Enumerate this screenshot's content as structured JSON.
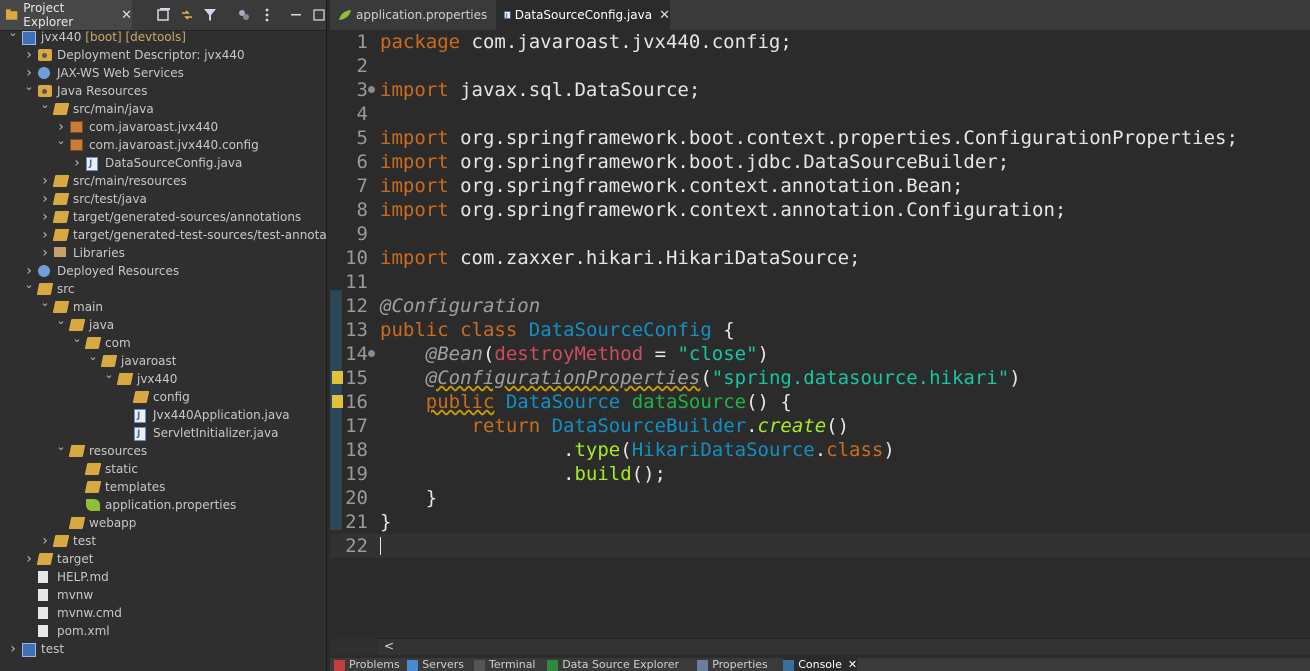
{
  "explorer": {
    "title": "Project Explorer",
    "close": "✕",
    "tree": [
      {
        "label": "jvx440",
        "deco": " [boot] [devtools]",
        "icon": "project-icon",
        "arrow": "v",
        "indent": 0
      },
      {
        "label": "Deployment Descriptor: jvx440",
        "icon": "descriptor-icon",
        "arrow": ">",
        "indent": 1
      },
      {
        "label": "JAX-WS Web Services",
        "icon": "webservices-icon",
        "arrow": ">",
        "indent": 1
      },
      {
        "label": "Java Resources",
        "icon": "java-resources-icon",
        "arrow": "v",
        "indent": 1
      },
      {
        "label": "src/main/java",
        "icon": "source-folder-icon",
        "arrow": "v",
        "indent": 2
      },
      {
        "label": "com.javaroast.jvx440",
        "icon": "package-icon",
        "arrow": ">",
        "indent": 3
      },
      {
        "label": "com.javaroast.jvx440.config",
        "icon": "package-icon",
        "arrow": "v",
        "indent": 3
      },
      {
        "label": "DataSourceConfig.java",
        "icon": "java-file-icon",
        "arrow": ">",
        "indent": 4
      },
      {
        "label": "src/main/resources",
        "icon": "source-folder-icon",
        "arrow": ">",
        "indent": 2
      },
      {
        "label": "src/test/java",
        "icon": "source-folder-icon",
        "arrow": ">",
        "indent": 2
      },
      {
        "label": "target/generated-sources/annotations",
        "icon": "source-folder-icon",
        "arrow": ">",
        "indent": 2
      },
      {
        "label": "target/generated-test-sources/test-annotations",
        "icon": "source-folder-icon",
        "arrow": ">",
        "indent": 2
      },
      {
        "label": "Libraries",
        "icon": "library-icon",
        "arrow": ">",
        "indent": 2
      },
      {
        "label": "Deployed Resources",
        "icon": "deployed-resources-icon",
        "arrow": ">",
        "indent": 1
      },
      {
        "label": "src",
        "icon": "folder-icon",
        "arrow": "v",
        "indent": 1
      },
      {
        "label": "main",
        "icon": "folder-icon",
        "arrow": "v",
        "indent": 2
      },
      {
        "label": "java",
        "icon": "folder-icon",
        "arrow": "v",
        "indent": 3
      },
      {
        "label": "com",
        "icon": "folder-icon",
        "arrow": "v",
        "indent": 4
      },
      {
        "label": "javaroast",
        "icon": "folder-icon",
        "arrow": "v",
        "indent": 5
      },
      {
        "label": "jvx440",
        "icon": "folder-icon",
        "arrow": "v",
        "indent": 6
      },
      {
        "label": "config",
        "icon": "folder-icon",
        "arrow": "",
        "indent": 7
      },
      {
        "label": "Jvx440Application.java",
        "icon": "java-file-icon",
        "arrow": "",
        "indent": 7
      },
      {
        "label": "ServletInitializer.java",
        "icon": "java-file-icon",
        "arrow": "",
        "indent": 7
      },
      {
        "label": "resources",
        "icon": "folder-icon",
        "arrow": "v",
        "indent": 3
      },
      {
        "label": "static",
        "icon": "folder-icon",
        "arrow": "",
        "indent": 4
      },
      {
        "label": "templates",
        "icon": "folder-icon",
        "arrow": "",
        "indent": 4
      },
      {
        "label": "application.properties",
        "icon": "properties-icon",
        "arrow": "",
        "indent": 4
      },
      {
        "label": "webapp",
        "icon": "folder-icon",
        "arrow": "",
        "indent": 3
      },
      {
        "label": "test",
        "icon": "folder-icon",
        "arrow": ">",
        "indent": 2
      },
      {
        "label": "target",
        "icon": "folder-icon",
        "arrow": ">",
        "indent": 1
      },
      {
        "label": "HELP.md",
        "icon": "file-icon",
        "arrow": "",
        "indent": 1
      },
      {
        "label": "mvnw",
        "icon": "file-icon",
        "arrow": "",
        "indent": 1
      },
      {
        "label": "mvnw.cmd",
        "icon": "file-icon",
        "arrow": "",
        "indent": 1
      },
      {
        "label": "pom.xml",
        "icon": "file-icon",
        "arrow": "",
        "indent": 1
      },
      {
        "label": "test",
        "icon": "project-icon",
        "arrow": ">",
        "indent": 0
      }
    ]
  },
  "editor": {
    "tabs": [
      {
        "label": "application.properties",
        "icon": "properties-icon",
        "active": false
      },
      {
        "label": "DataSourceConfig.java",
        "icon": "java-file-icon",
        "active": true,
        "close": "✕"
      }
    ],
    "lines": [
      {
        "n": "1",
        "html": "<span class='kw'>package</span> com.javaroast.jvx440.config;"
      },
      {
        "n": "2",
        "html": ""
      },
      {
        "n": "3",
        "html": "<span class='kw'>import</span> javax.sql.DataSource;",
        "fold": true
      },
      {
        "n": "4",
        "html": ""
      },
      {
        "n": "5",
        "html": "<span class='kw'>import</span> org.springframework.boot.context.properties.ConfigurationProperties;"
      },
      {
        "n": "6",
        "html": "<span class='kw'>import</span> org.springframework.boot.jdbc.DataSourceBuilder;"
      },
      {
        "n": "7",
        "html": "<span class='kw'>import</span> org.springframework.context.annotation.Bean;"
      },
      {
        "n": "8",
        "html": "<span class='kw'>import</span> org.springframework.context.annotation.Configuration;"
      },
      {
        "n": "9",
        "html": ""
      },
      {
        "n": "10",
        "html": "<span class='kw'>import</span> com.zaxxer.hikari.HikariDataSource;"
      },
      {
        "n": "11",
        "html": ""
      },
      {
        "n": "12",
        "html": "<span class='ann'>@Configuration</span>"
      },
      {
        "n": "13",
        "html": "<span class='kw'>public</span> <span class='kw'>class</span> <span class='cls'>DataSourceConfig</span> {"
      },
      {
        "n": "14",
        "html": "    <span class='ann'>@Bean</span>(<span class='param'>destroyMethod</span> = <span class='str'>\"close\"</span>)",
        "fold": true
      },
      {
        "n": "15",
        "html": "    <span class='ann-u'>@ConfigurationProperties</span>(<span class='str'>\"spring.datasource.hikari\"</span>)",
        "marker": true
      },
      {
        "n": "16",
        "html": "    <span class='kw-u'>public</span> <span class='cls'>DataSource</span> <span class='mth'>dataSource</span>() {",
        "marker": true
      },
      {
        "n": "17",
        "html": "        <span class='kw'>return</span> <span class='cls'>DataSourceBuilder</span>.<span class='italic-m'>create</span>()"
      },
      {
        "n": "18",
        "html": "                .<span class='chain'>type</span>(<span class='cls'>HikariDataSource</span>.<span class='kw'>class</span>)"
      },
      {
        "n": "19",
        "html": "                .<span class='chain'>build</span>();"
      },
      {
        "n": "20",
        "html": "    }"
      },
      {
        "n": "21",
        "html": "}"
      },
      {
        "n": "22",
        "html": "",
        "current": true
      }
    ],
    "hscroll_label": "<"
  },
  "bottom": {
    "tabs": [
      {
        "label": "Problems",
        "icon": "problems-icon"
      },
      {
        "label": "Servers",
        "icon": "servers-icon"
      },
      {
        "label": "Terminal",
        "icon": "terminal-icon"
      },
      {
        "label": "Data Source Explorer",
        "icon": "datasource-icon"
      },
      {
        "label": "Properties",
        "icon": "properties-view-icon"
      },
      {
        "label": "Console",
        "icon": "console-icon",
        "active": true,
        "close": "✕"
      }
    ]
  }
}
